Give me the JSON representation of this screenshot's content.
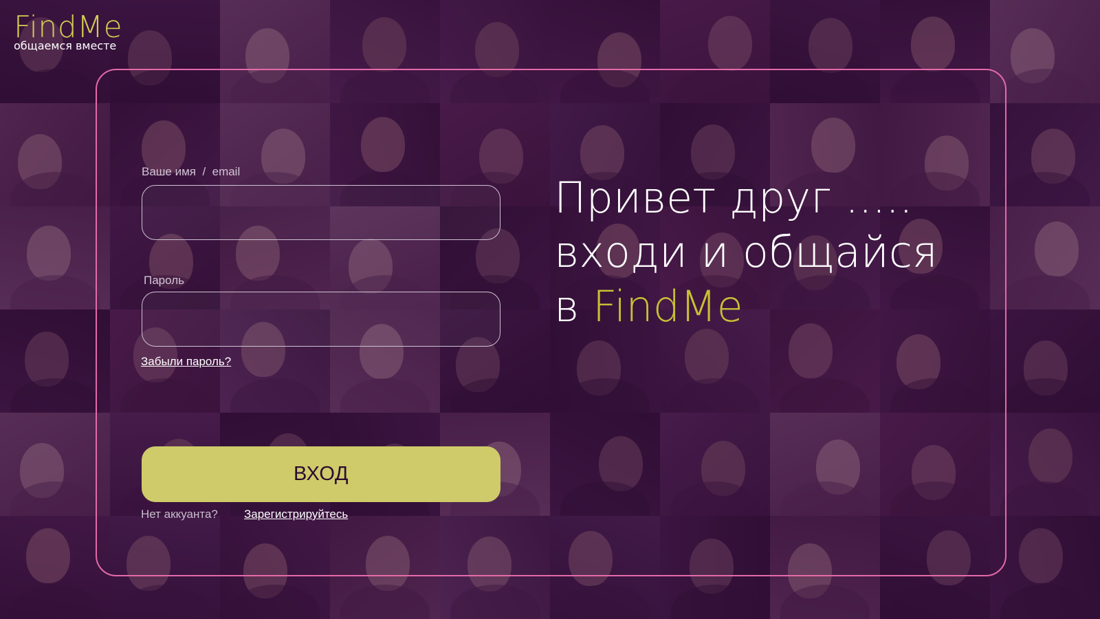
{
  "logo": {
    "name": "FindMe",
    "tagline": "общаемся вместе"
  },
  "login_form": {
    "username_label": "Ваше имя  /  email",
    "username_value": "",
    "password_label": "Пароль",
    "password_value": "",
    "forgot_password": "Забыли пароль?",
    "submit_label": "ВХОД",
    "no_account": "Нет аккуанта?",
    "register": "Зарегистрируйтесь"
  },
  "greeting": {
    "line1": "Привет друг .....",
    "line2": "входи и общайся",
    "line3_prefix": "в ",
    "line3_brand": "FindMe"
  },
  "colors": {
    "background_overlay": "#3a0a42",
    "accent_yellow": "#d4cc52",
    "frame_pink": "#e46aa9",
    "button": "#cfcb6a"
  }
}
